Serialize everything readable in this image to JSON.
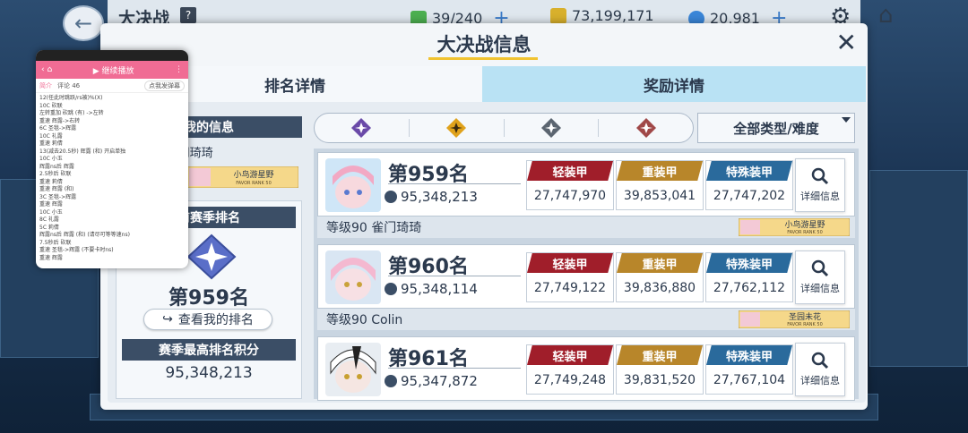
{
  "header": {
    "title": "大决战",
    "help": "?",
    "stamina": "39/240",
    "credits": "73,199,171",
    "gems": "20,981",
    "plus": "+"
  },
  "dialog": {
    "title": "大决战信息",
    "close": "✕",
    "tabs": {
      "rank": "排名详情",
      "reward": "奖励详情"
    }
  },
  "my_info": {
    "heading": "我的信息",
    "level_name": "等级90  雀门琦琦",
    "student_tag": "小鸟游星野",
    "tag_sub": "FAVOR RANK 50",
    "season_heading": "前赛季排名",
    "rank": "第959名",
    "view_button": "查看我的排名",
    "best_heading": "赛季最高排名积分",
    "best_score": "95,348,213"
  },
  "filter": {
    "dropdown": "全部类型/难度",
    "icons": [
      "torment-icon",
      "insane-icon",
      "extreme-icon",
      "hardcore-icon"
    ]
  },
  "armor_labels": {
    "light": "轻装甲",
    "heavy": "重装甲",
    "special": "特殊装甲"
  },
  "detail_label": "详细信息",
  "entries": [
    {
      "rank": "第959名",
      "score": "95,348,213",
      "light": "27,747,970",
      "heavy": "39,853,041",
      "special": "27,747,202",
      "player": "等级90  雀门琦琦",
      "student": "小鸟游星野",
      "tag_sub": "FAVOR RANK 50"
    },
    {
      "rank": "第960名",
      "score": "95,348,114",
      "light": "27,749,122",
      "heavy": "39,836,880",
      "special": "27,762,112",
      "player": "等级90  Colin",
      "student": "圣园未花",
      "tag_sub": "FAVOR RANK 50"
    },
    {
      "rank": "第961名",
      "score": "95,347,872",
      "light": "27,749,248",
      "heavy": "39,831,520",
      "special": "27,767,104",
      "player": "",
      "student": "",
      "tag_sub": ""
    }
  ],
  "overlay": {
    "play_label": "▶ 继续播放",
    "tab_intro": "简介",
    "tab_comments": "评论 46",
    "danmu": "点我发弹幕",
    "lines": [
      "12(任此时跳跃/rs被)%(X)",
      "10C 砍联",
      "左转重加 砍跳 (有) ->左转",
      "重速 辉露->右转",
      "6C 圣毯->辉露",
      "10C 礼露",
      "重速 莉倩",
      "13(减去20.5秒) 辉露 (和) 开启单独",
      "10C 小玉",
      "辉露ns后 辉露",
      "2.5秒后 砍联",
      "重速 莉倩",
      "重速 辉露 (和)",
      "3C 圣毯->辉露",
      "重速 辉露",
      "10C 小玉",
      "8C 礼露",
      "5C 莉倩",
      "辉露ns后 辉露 (和) (请尽可等等速ns)",
      "7.5秒后 砍联",
      "重速 圣毯->辉露 (不要卡时ns)",
      "重速 辉露"
    ]
  },
  "colors": {
    "light": "#a01e2a",
    "heavy": "#b8862a",
    "special": "#2a6a9c",
    "tab_reward": "#b9e2f4",
    "accent": "#f1c331"
  }
}
